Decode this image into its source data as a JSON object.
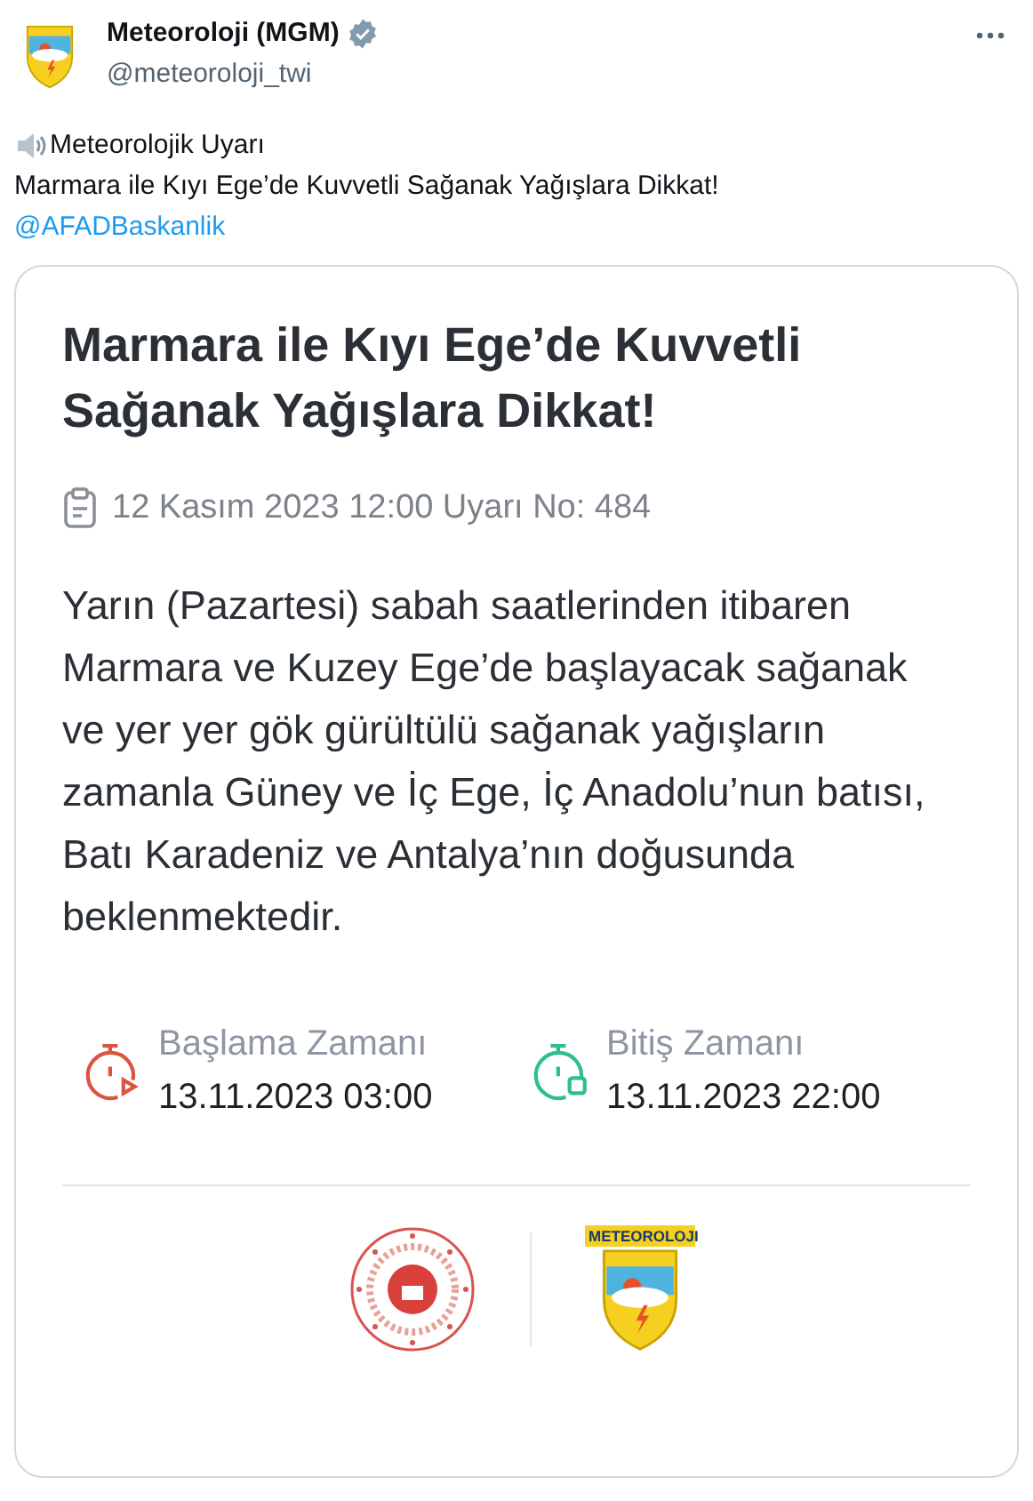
{
  "author": {
    "name": "Meteoroloji (MGM)",
    "verified": true,
    "handle": "@meteoroloji_twi"
  },
  "tweet": {
    "heading": "Meteorolojik Uyarı",
    "line": "Marmara ile Kıyı Ege’de Kuvvetli Sağanak Yağışlara Dikkat!",
    "mention": "@AFADBaskanlik"
  },
  "card": {
    "title": "Marmara ile Kıyı Ege’de Kuvvetli Sağanak Yağışlara Dikkat!",
    "meta": "12 Kasım 2023 12:00 Uyarı No: 484",
    "body": "Yarın (Pazartesi) sabah saatlerinden itibaren Marmara ve Kuzey Ege’de başlayacak sağanak ve yer yer gök gürültülü sağanak yağışların zamanla Güney ve İç Ege, İç Anadolu’nun batısı, Batı Karadeniz ve Antalya’nın doğusunda beklenmektedir.",
    "times": [
      {
        "kind": "start",
        "label": "Başlama Zamanı",
        "value": "13.11.2023 03:00"
      },
      {
        "kind": "end",
        "label": "Bitiş Zamanı",
        "value": "13.11.2023 22:00"
      }
    ],
    "logo_text": "METEOROLOJI"
  }
}
